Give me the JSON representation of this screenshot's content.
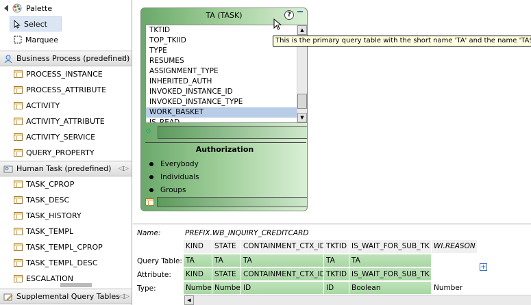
{
  "palette": {
    "title": "Palette",
    "tools": [
      {
        "label": "Select"
      },
      {
        "label": "Marquee"
      }
    ],
    "drawers": {
      "business": {
        "label": "Business Process (predefined)",
        "items": [
          "PROCESS_INSTANCE",
          "PROCESS_ATTRIBUTE",
          "ACTIVITY",
          "ACTIVITY_ATTRIBUTE",
          "ACTIVITY_SERVICE",
          "QUERY_PROPERTY"
        ]
      },
      "human": {
        "label": "Human Task (predefined)",
        "items": [
          "TASK_CPROP",
          "TASK_DESC",
          "TASK_HISTORY",
          "TASK_TEMPL",
          "TASK_TEMPL_CPROP",
          "TASK_TEMPL_DESC",
          "ESCALATION"
        ]
      },
      "supplemental": {
        "label": "Supplemental Query Tables"
      }
    }
  },
  "node": {
    "title": "TA (TASK)",
    "help_glyph": "?",
    "columns": [
      "TKTID",
      "TOP_TKIID",
      "TYPE",
      "RESUMES",
      "ASSIGNMENT_TYPE",
      "INHERITED_AUTH",
      "INVOKED_INSTANCE_ID",
      "INVOKED_INSTANCE_TYPE",
      "WORK_BASKET",
      "IS_READ"
    ],
    "selected_column": "WORK_BASKET",
    "authorization": {
      "title": "Authorization",
      "items": [
        "Everybody",
        "Individuals",
        "Groups"
      ]
    }
  },
  "tooltip": "This is the primary query table with the short name 'TA' and the name 'TASK'.",
  "properties": {
    "name_label": "Name:",
    "name_value": "PREFIX.WB_INQUIRY_CREDITCARD",
    "row_labels": {
      "query_table": "Query Table:",
      "attribute": "Attribute:",
      "type": "Type:"
    },
    "headers": [
      "KIND",
      "STATE",
      "CONTAINMENT_CTX_ID",
      "TKTID",
      "IS_WAIT_FOR_SUB_TK",
      "WI.REASON"
    ],
    "query_table": [
      "TA",
      "TA",
      "TA",
      "TA",
      "TA",
      ""
    ],
    "attribute": [
      "KIND",
      "STATE",
      "CONTAINMENT_CTX_ID",
      "TKTID",
      "IS_WAIT_FOR_SUB_TK",
      ""
    ],
    "type": [
      "Number",
      "Number",
      "ID",
      "ID",
      "Boolean",
      "Number"
    ],
    "add_glyph": "+"
  }
}
